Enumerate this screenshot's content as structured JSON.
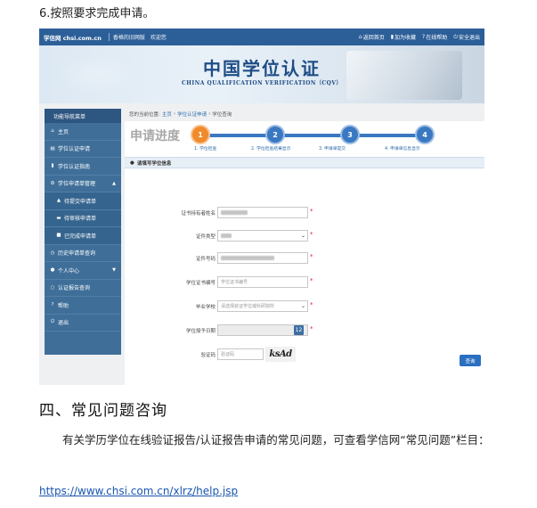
{
  "step_title": "6.按照要求完成申请。",
  "topbar": {
    "logo": "学信网 chsi.com.cn",
    "links": [
      "香格的旧网版",
      "欢迎您"
    ],
    "right": [
      {
        "icon": "home-icon",
        "glyph": "⌂",
        "label": "返回首页"
      },
      {
        "icon": "bookmark-icon",
        "glyph": "▮",
        "label": "加为收藏"
      },
      {
        "icon": "help-icon",
        "glyph": "?",
        "label": "在线帮助"
      },
      {
        "icon": "logout-icon",
        "glyph": "⏻",
        "label": "安全退出"
      }
    ]
  },
  "banner": {
    "title": "中国学位认证",
    "subtitle": "CHINA QUALIFICATION VERIFICATION（CQV）"
  },
  "sidebar": {
    "header": "功能导航菜单",
    "items": [
      {
        "icon": "home-icon",
        "glyph": "⌂",
        "label": "主页",
        "sub": false
      },
      {
        "icon": "doc-icon",
        "glyph": "▤",
        "label": "学位认证申请",
        "sub": false
      },
      {
        "icon": "book-icon",
        "glyph": "▮",
        "label": "学位认证指南",
        "sub": false
      },
      {
        "icon": "gear-icon",
        "glyph": "⚙",
        "label": "学位申请单管理",
        "sub": false,
        "caret": "▲"
      },
      {
        "icon": "warning-icon",
        "glyph": "▲",
        "label": "待提交申请单",
        "sub": true
      },
      {
        "icon": "cart-icon",
        "glyph": "▬",
        "label": "待审核申请单",
        "sub": true
      },
      {
        "icon": "check-icon",
        "glyph": "■",
        "label": "已完成申请单",
        "sub": true
      },
      {
        "icon": "history-icon",
        "glyph": "◷",
        "label": "历史申请单查询",
        "sub": false
      },
      {
        "icon": "user-icon",
        "glyph": "●",
        "label": "个人中心",
        "sub": false,
        "caret": "▼"
      },
      {
        "icon": "search-icon",
        "glyph": "○",
        "label": "认证报告查询",
        "sub": false
      },
      {
        "icon": "help-icon",
        "glyph": "?",
        "label": "帮助",
        "sub": false
      },
      {
        "icon": "logout-icon",
        "glyph": "⏻",
        "label": "退出",
        "sub": false
      }
    ]
  },
  "breadcrumb": {
    "prefix": "您的当前位置:",
    "links": [
      "主页",
      "学位认证申请",
      "学位查询"
    ],
    "separator": "›"
  },
  "progress": {
    "title": "申请进度",
    "steps": [
      {
        "num": "1",
        "label": "1. 学位检查",
        "state": "active"
      },
      {
        "num": "2",
        "label": "2. 学位检查结果显示",
        "state": "pending"
      },
      {
        "num": "3",
        "label": "3. 申请单提交",
        "state": "pending"
      },
      {
        "num": "4",
        "label": "4. 申请单信息显示",
        "state": "pending"
      }
    ]
  },
  "form": {
    "section_title": "请填写学位信息",
    "fields": [
      {
        "label": "证书持有者姓名",
        "placeholder": "",
        "type": "text",
        "required": true,
        "blurred": true
      },
      {
        "label": "证件类型",
        "placeholder": "",
        "type": "select",
        "required": true,
        "blurred": true
      },
      {
        "label": "证件号码",
        "placeholder": "",
        "type": "text",
        "required": true,
        "blurred": true
      },
      {
        "label": "学位证书编号",
        "placeholder": "学位证书编号",
        "type": "text",
        "required": true,
        "blurred": false
      },
      {
        "label": "毕业学校",
        "placeholder": "请选择获证学位或科研院所",
        "type": "select",
        "required": true,
        "blurred": false
      },
      {
        "label": "学位授予日期",
        "placeholder": "",
        "type": "date",
        "required": true,
        "blurred": false
      },
      {
        "label": "验证码",
        "placeholder": "验证码",
        "type": "captcha",
        "required": false,
        "blurred": false
      }
    ],
    "captcha_text": "ksAd",
    "calendar_glyph": "12",
    "required_mark": "*",
    "submit_label": "查询"
  },
  "faq": {
    "heading": "四、常见问题咨询",
    "paragraph": "有关学历学位在线验证报告/认证报告申请的常见问题，可查看学信网“常见问题”栏目：",
    "link": "https://www.chsi.com.cn/xlrz/help.jsp"
  },
  "colors": {
    "brand": "#2c5f98",
    "sidebar": "#3f6f99",
    "active_step": "#f08a2a",
    "pending_step": "#3a78c2",
    "submit": "#2a6fc0"
  }
}
